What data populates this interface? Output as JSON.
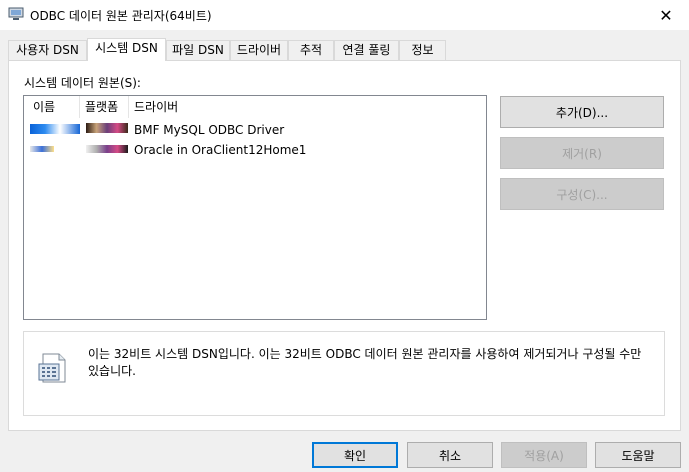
{
  "window": {
    "title": "ODBC 데이터 원본 관리자(64비트)",
    "close_glyph": "✕"
  },
  "tabs": [
    {
      "label": "사용자 DSN"
    },
    {
      "label": "시스템 DSN"
    },
    {
      "label": "파일 DSN"
    },
    {
      "label": "드라이버"
    },
    {
      "label": "추적"
    },
    {
      "label": "연결 풀링"
    },
    {
      "label": "정보"
    }
  ],
  "active_tab": "시스템 DSN",
  "main": {
    "section_label": "시스템 데이터 원본(S):",
    "columns": [
      "이름",
      "플랫폼",
      "드라이버"
    ],
    "rows": [
      {
        "driver": "BMF MySQL ODBC Driver"
      },
      {
        "driver": "Oracle in OraClient12Home1"
      }
    ],
    "buttons": {
      "add": "추가(D)...",
      "remove": "제거(R)",
      "configure": "구성(C)..."
    },
    "info_text": "이는 32비트 시스템 DSN입니다. 이는 32비트 ODBC 데이터 원본 관리자를 사용하여 제거되거나 구성될 수만 있습니다."
  },
  "footer": {
    "ok": "확인",
    "cancel": "취소",
    "apply": "적용(A)",
    "help": "도움말"
  },
  "colors": {
    "accent": "#0078d7",
    "disabled_text": "#a0a0a0"
  }
}
